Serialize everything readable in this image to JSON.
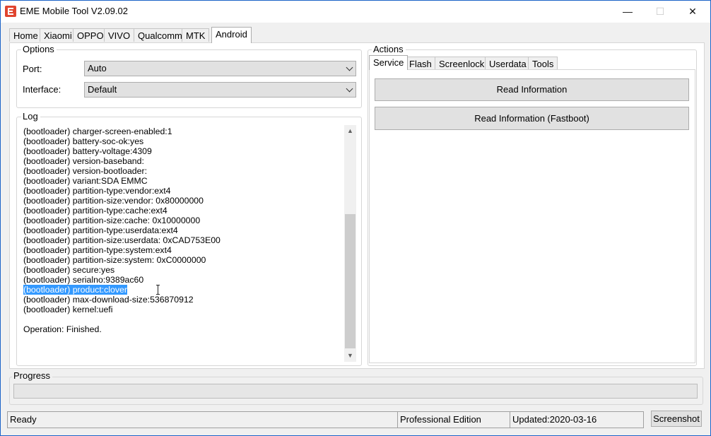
{
  "window": {
    "title": "EME Mobile Tool V2.09.02",
    "minimize": "—",
    "maximize": "☐",
    "close": "✕"
  },
  "main_tabs": [
    "Home",
    "Xiaomi",
    "OPPO",
    "VIVO",
    "Qualcomm",
    "MTK",
    "Android"
  ],
  "main_tabs_active": "Android",
  "options": {
    "legend": "Options",
    "port_label": "Port:",
    "port_value": "Auto",
    "interface_label": "Interface:",
    "interface_value": "Default"
  },
  "log": {
    "legend": "Log",
    "lines": [
      "(bootloader) charger-screen-enabled:1",
      "(bootloader) battery-soc-ok:yes",
      "(bootloader) battery-voltage:4309",
      "(bootloader) version-baseband:",
      "(bootloader) version-bootloader:",
      "(bootloader) variant:SDA EMMC",
      "(bootloader) partition-type:vendor:ext4",
      "(bootloader) partition-size:vendor: 0x80000000",
      "(bootloader) partition-type:cache:ext4",
      "(bootloader) partition-size:cache: 0x10000000",
      "(bootloader) partition-type:userdata:ext4",
      "(bootloader) partition-size:userdata: 0xCAD753E00",
      "(bootloader) partition-type:system:ext4",
      "(bootloader) partition-size:system: 0xC0000000",
      "(bootloader) secure:yes",
      "(bootloader) serialno:9389ac60",
      "(bootloader) product:clover",
      "(bootloader) max-download-size:536870912",
      "(bootloader) kernel:uefi",
      "",
      "Operation: Finished."
    ],
    "selected_line_index": 16,
    "scroll_up": "▲",
    "scroll_down": "▼"
  },
  "actions": {
    "legend": "Actions",
    "tabs": [
      "Service",
      "Flash",
      "Screenlock",
      "Userdata",
      "Tools"
    ],
    "active_tab": "Service",
    "buttons": [
      "Read Information",
      "Read Information (Fastboot)"
    ]
  },
  "progress": {
    "legend": "Progress",
    "value": 0
  },
  "statusbar": {
    "status": "Ready",
    "edition": "Professional Edition",
    "updated": "Updated:2020-03-16",
    "screenshot_button": "Screenshot"
  },
  "colors": {
    "app_icon": "#e0452f",
    "window_border": "#1c64c8",
    "selection": "#3399ff",
    "background": "#f0f0f0"
  }
}
